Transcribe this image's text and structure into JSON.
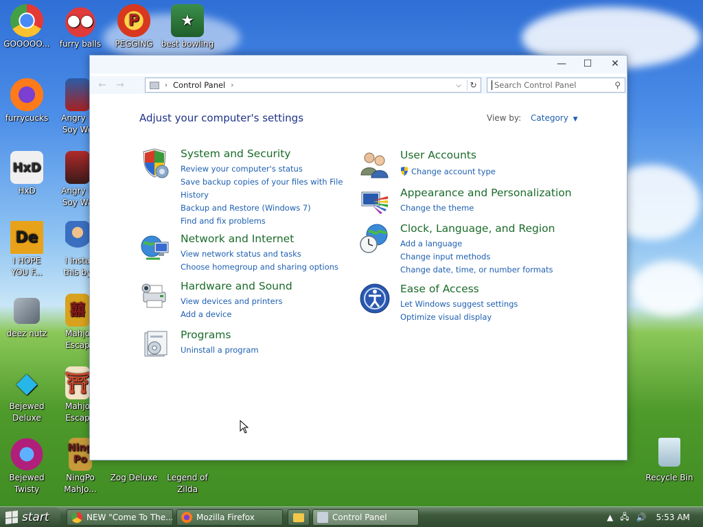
{
  "desktop": {
    "icons": [
      {
        "label": "GOOOOO...",
        "icon": "chrome-icon",
        "color": "#e9c93a"
      },
      {
        "label": "furry balls",
        "icon": "furry-ball-icon",
        "color": "#d42a2a"
      },
      {
        "label": "PEGGING",
        "icon": "peggle-icon",
        "color": "#d8381e"
      },
      {
        "label": "best bowling",
        "icon": "bowling-icon",
        "color": "#3b8f4a"
      },
      {
        "label": "furrycucks",
        "icon": "firefox-icon",
        "color": "#ff7b1a"
      },
      {
        "label": "Angry B\nSoy Wo",
        "icon": "angry-birds-starwars-icon",
        "color": "#2a5da8"
      },
      {
        "label": "HxD",
        "icon": "hxd-icon",
        "color": "#f0b32c"
      },
      {
        "label": "Angry B\nSoy Wa",
        "icon": "angry-birds-starwars-2-icon",
        "color": "#b02a2a"
      },
      {
        "label": "I HOPE\nYOU F...",
        "icon": "de-icon",
        "color": "#e8a21a"
      },
      {
        "label": "I insta\nthis by",
        "icon": "character-icon",
        "color": "#3a6fc0"
      },
      {
        "label": "deez nutz",
        "icon": "windows-stack-icon",
        "color": "#7b8793"
      },
      {
        "label": "Mahjo\nEscap",
        "icon": "mahjong-icon",
        "color": "#d8a21e"
      },
      {
        "label": "Bejewed\nDeluxe",
        "icon": "bejeweled-icon",
        "color": "#27b6e8"
      },
      {
        "label": "Mahjo\nEscap",
        "icon": "mahjong-gate-icon",
        "color": "#d04a2a"
      },
      {
        "label": "Bejewed\nTwisty",
        "icon": "bejeweled-twist-icon",
        "color": "#b0207a"
      },
      {
        "label": "NingPo\nMahJo...",
        "icon": "ningpo-icon",
        "color": "#c69a3a"
      },
      {
        "label": "Zog Deluxe",
        "icon": "zog-icon",
        "color": "#b03a2a"
      },
      {
        "label": "Legend of\nZilda",
        "icon": "zilda-icon",
        "color": "#3a8a3a"
      },
      {
        "label": "Recycle Bin",
        "icon": "recycle-bin-icon",
        "color": "#a9c7d8"
      }
    ]
  },
  "window": {
    "minimize": "—",
    "maximize": "☐",
    "close": "✕",
    "back": "←",
    "forward": "→",
    "breadcrumb_sep": "›",
    "address": "Control Panel",
    "search_placeholder": "Search Control Panel",
    "heading": "Adjust your computer's settings",
    "view_by_label": "View by:",
    "view_by_value": "Category"
  },
  "categories": [
    {
      "title": "System and Security",
      "icon": "shield-icon",
      "links": [
        "Review your computer's status",
        "Save backup copies of your files with File History",
        "Backup and Restore (Windows 7)",
        "Find and fix problems"
      ]
    },
    {
      "title": "Network and Internet",
      "icon": "network-globe-icon",
      "links": [
        "View network status and tasks",
        "Choose homegroup and sharing options"
      ]
    },
    {
      "title": "Hardware and Sound",
      "icon": "printer-icon",
      "links": [
        "View devices and printers",
        "Add a device"
      ]
    },
    {
      "title": "Programs",
      "icon": "programs-icon",
      "links": [
        "Uninstall a program"
      ]
    },
    {
      "title": "User Accounts",
      "icon": "users-icon",
      "links": [
        "Change account type"
      ]
    },
    {
      "title": "Appearance and Personalization",
      "icon": "display-colors-icon",
      "links": [
        "Change the theme"
      ]
    },
    {
      "title": "Clock, Language, and Region",
      "icon": "clock-globe-icon",
      "links": [
        "Add a language",
        "Change input methods",
        "Change date, time, or number formats"
      ]
    },
    {
      "title": "Ease of Access",
      "icon": "ease-of-access-icon",
      "links": [
        "Let Windows suggest settings",
        "Optimize visual display"
      ]
    }
  ],
  "taskbar": {
    "start_label": "start",
    "buttons": [
      {
        "label": "NEW \"Come To The...",
        "icon": "chrome-icon"
      },
      {
        "label": "Mozilla Firefox",
        "icon": "firefox-icon"
      },
      {
        "label": "",
        "icon": "file-explorer-icon"
      },
      {
        "label": "Control Panel",
        "icon": "control-panel-icon"
      }
    ],
    "clock": "5:53 AM"
  }
}
